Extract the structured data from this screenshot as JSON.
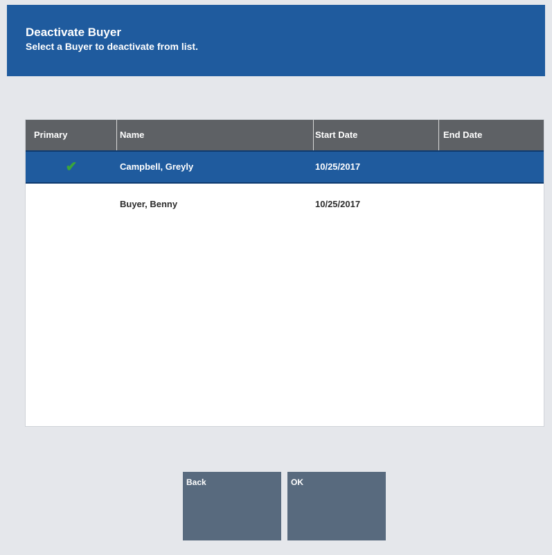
{
  "header": {
    "title": "Deactivate Buyer",
    "subtitle": "Select a Buyer to deactivate from list."
  },
  "table": {
    "columns": [
      "Primary",
      "Name",
      "Start Date",
      "End Date"
    ],
    "rows": [
      {
        "primary": "✔",
        "name": "Campbell, Greyly",
        "start_date": "10/25/2017",
        "end_date": "",
        "selected": true
      },
      {
        "primary": "",
        "name": "Buyer, Benny",
        "start_date": "10/25/2017",
        "end_date": "",
        "selected": false
      }
    ]
  },
  "buttons": {
    "back_label": "Back",
    "ok_label": "OK"
  },
  "colors": {
    "header_bg": "#1f5b9e",
    "table_header_bg": "#5e6165",
    "selected_row_bg": "#1f5b9e",
    "button_bg": "#586a7e",
    "check_green": "#3aa53a"
  }
}
